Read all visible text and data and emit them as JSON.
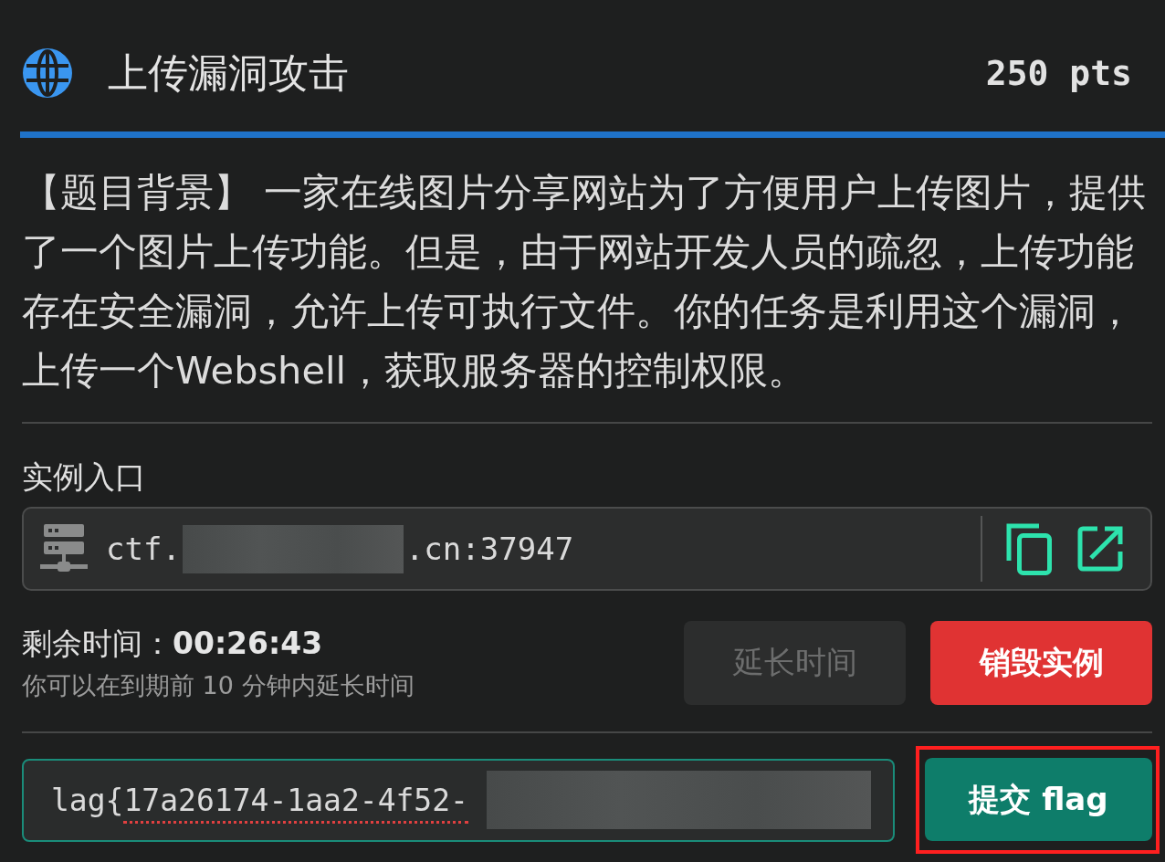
{
  "header": {
    "title": "上传漏洞攻击",
    "points": "250 pts"
  },
  "description": "【题目背景】 一家在线图片分享网站为了方便用户上传图片，提供了一个图片上传功能。但是，由于网站开发人员的疏忽，上传功能存在安全漏洞，允许上传可执行文件。你的任务是利用这个漏洞，上传一个Webshell，获取服务器的控制权限。",
  "instance": {
    "label": "实例入口",
    "address": {
      "prefix": "ctf.",
      "redacted": true,
      "suffix": ".cn:37947"
    }
  },
  "timer": {
    "label": "剩余时间：",
    "value": "00:26:43",
    "hint": "你可以在到期前 10 分钟内延长时间"
  },
  "actions": [
    {
      "kind": "extend",
      "label": "延长时间",
      "disabled": true
    },
    {
      "kind": "destroy",
      "label": "销毁实例",
      "disabled": false
    }
  ],
  "flag_form": {
    "focused": true,
    "value_segments": [
      {
        "text": "lag{",
        "misspelled": false
      },
      {
        "text": "17a26174-1aa2-4f52-",
        "misspelled": true
      }
    ],
    "redacted": true,
    "submit": {
      "label": "提交 flag",
      "highlighted": true
    }
  }
}
